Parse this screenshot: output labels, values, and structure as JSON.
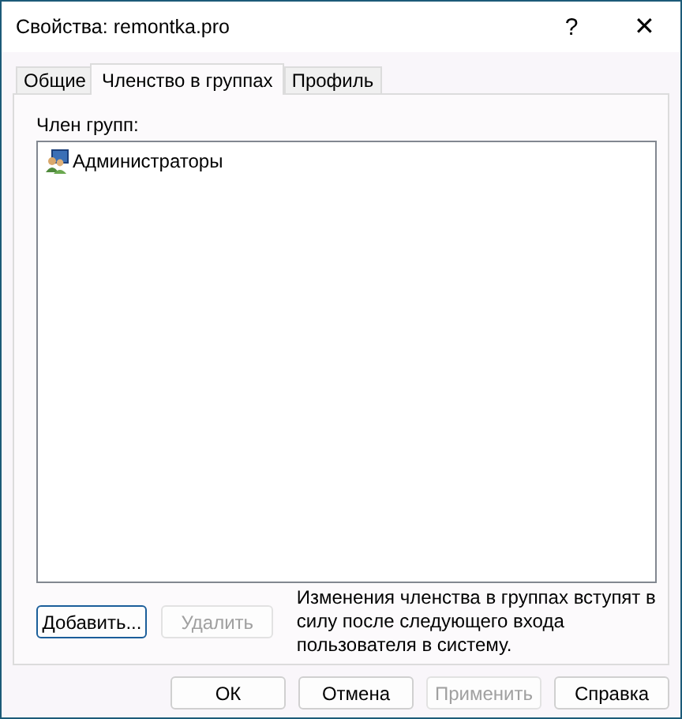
{
  "window": {
    "title": "Свойства: remontka.pro",
    "help_button": "?",
    "close_button": "✕"
  },
  "tabs": [
    {
      "label": "Общие",
      "selected": false
    },
    {
      "label": "Членство в группах",
      "selected": true
    },
    {
      "label": "Профиль",
      "selected": false
    }
  ],
  "groups": {
    "label": "Член групп:",
    "items": [
      {
        "name": "Администраторы",
        "selected": false
      }
    ]
  },
  "add_button": {
    "label": "Добавить...",
    "disabled": false
  },
  "remove_button": {
    "label": "Удалить",
    "disabled": true
  },
  "note_lines": [
    "Изменения членства в группах вступят в",
    "силу после следующего входа",
    "пользователя в систему."
  ],
  "buttons": [
    {
      "label": "ОК",
      "disabled": false
    },
    {
      "label": "Отмена",
      "disabled": false
    },
    {
      "label": "Применить",
      "disabled": true
    },
    {
      "label": "Справка",
      "disabled": false
    }
  ]
}
